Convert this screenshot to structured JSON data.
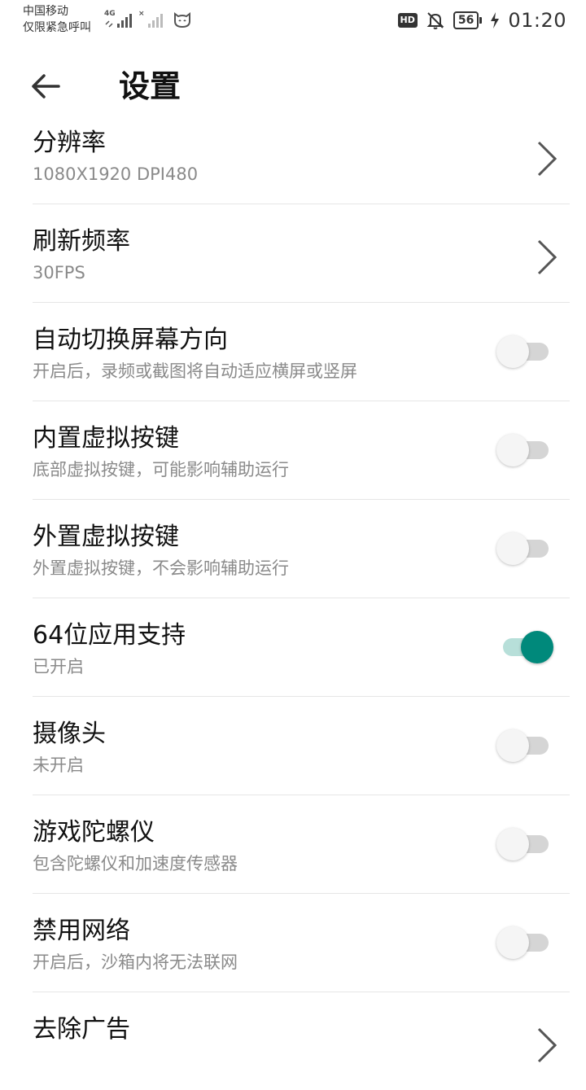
{
  "status_bar": {
    "carrier": "中国移动",
    "carrier_note": "仅限紧急呼叫",
    "network_label": "4G",
    "second_sim_label": "×",
    "hd_label": "HD",
    "battery_level": "56",
    "time": "01:20",
    "icons": [
      "signal-4g-icon",
      "signal-no-sim-icon",
      "cat-face-icon",
      "hd-icon",
      "bell-off-icon",
      "battery-icon",
      "charging-bolt-icon"
    ]
  },
  "header": {
    "title": "设置",
    "back_icon": "arrow-left-icon"
  },
  "colors": {
    "accent": "#00897b",
    "accent_track": "#b7dfd9",
    "toggle_off_track": "#d5d5d5",
    "subtitle": "#8a8a8a",
    "divider": "#e6e6e6"
  },
  "settings": [
    {
      "title": "分辨率",
      "subtitle": "1080X1920 DPI480",
      "control": "chevron"
    },
    {
      "title": "刷新频率",
      "subtitle": "30FPS",
      "control": "chevron"
    },
    {
      "title": "自动切换屏幕方向",
      "subtitle": "开启后，录频或截图将自动适应横屏或竖屏",
      "control": "toggle",
      "on": false
    },
    {
      "title": "内置虚拟按键",
      "subtitle": "底部虚拟按键，可能影响辅助运行",
      "control": "toggle",
      "on": false
    },
    {
      "title": "外置虚拟按键",
      "subtitle": "外置虚拟按键，不会影响辅助运行",
      "control": "toggle",
      "on": false
    },
    {
      "title": "64位应用支持",
      "subtitle": "已开启",
      "control": "toggle",
      "on": true
    },
    {
      "title": "摄像头",
      "subtitle": "未开启",
      "control": "toggle",
      "on": false
    },
    {
      "title": "游戏陀螺仪",
      "subtitle": "包含陀螺仪和加速度传感器",
      "control": "toggle",
      "on": false
    },
    {
      "title": "禁用网络",
      "subtitle": "开启后，沙箱内将无法联网",
      "control": "toggle",
      "on": false
    },
    {
      "title": "去除广告",
      "subtitle": "",
      "control": "chevron"
    }
  ]
}
